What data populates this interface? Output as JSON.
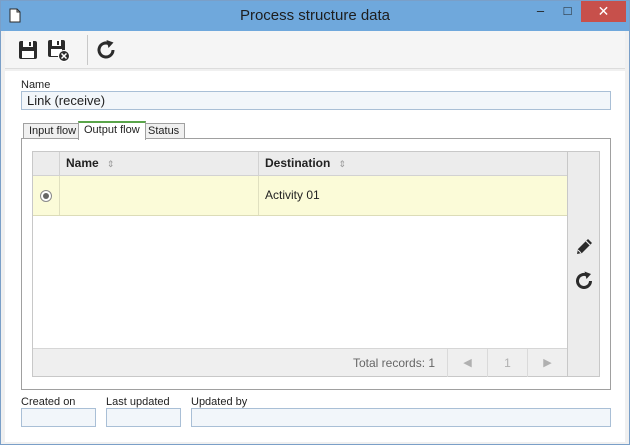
{
  "window": {
    "title": "Process structure data",
    "close_glyph": "✕",
    "minimize_glyph": "–",
    "maximize_glyph": "□"
  },
  "toolbar": {
    "icons": [
      "save-icon",
      "save-and-close-icon",
      "refresh-icon"
    ]
  },
  "form": {
    "name_label": "Name",
    "name_value": "Link (receive)"
  },
  "tabs": [
    {
      "label": "Input flow",
      "active": false
    },
    {
      "label": "Output flow",
      "active": true
    },
    {
      "label": "Status",
      "active": false
    }
  ],
  "grid": {
    "columns": [
      "Name",
      "Destination"
    ],
    "rows": [
      {
        "selected": true,
        "name": "",
        "destination": "Activity 01"
      }
    ],
    "footer": {
      "total_records": "Total records: 1",
      "page": "1",
      "prev_glyph": "◀",
      "next_glyph": "▶"
    },
    "sort_glyph": "⇕"
  },
  "side_actions": {
    "icons": [
      "edit-icon",
      "refresh-icon"
    ]
  },
  "footer": {
    "created_on_label": "Created on",
    "last_updated_label": "Last updated",
    "updated_by_label": "Updated by",
    "created_on_value": "",
    "last_updated_value": "",
    "updated_by_value": ""
  },
  "colors": {
    "titlebar": "#6fa8dc",
    "close_button": "#c7504b",
    "selected_row": "#fbfbd8",
    "active_tab_accent": "#5aa54a"
  }
}
